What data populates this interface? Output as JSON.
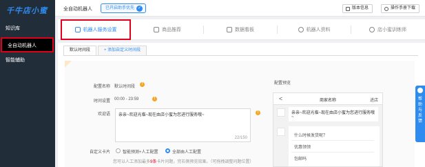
{
  "sidebar": {
    "logo": "千牛店小蜜",
    "items": [
      {
        "label": "知识库"
      },
      {
        "label": "全自动机器人"
      },
      {
        "label": "智能辅助"
      }
    ]
  },
  "topbar": {
    "title": "全自动机器人",
    "priority_badge": "已开启助手优先",
    "version_btn": "版本信息",
    "manual_btn": "操作手册下载"
  },
  "tabs": [
    {
      "label": "机器人服务设置",
      "icon": "robot-icon"
    },
    {
      "label": "商品推荐",
      "icon": "goods-icon"
    },
    {
      "label": "数据看板",
      "icon": "dashboard-icon"
    },
    {
      "label": "机器人资料",
      "icon": "robot-profile-icon"
    },
    {
      "label": "店小蜜训练师",
      "icon": "trainer-icon"
    }
  ],
  "subtabs": {
    "default": "默认时间段",
    "add_custom": "+ 添加自定义时间段"
  },
  "form": {
    "name_label": "配置名称",
    "name_value": "默认时间段",
    "time_label": "时间设置",
    "time_value": "00:00 - 23:59",
    "greeting_label": "欢迎语",
    "greeting_value": "亲亲~欢迎光临~现在由店小蜜为您进行服务哦~",
    "greeting_count": "22/150",
    "card_label": "自定义卡片",
    "option_smart": "智能预测+人工配置",
    "option_manual": "全部由人工配置",
    "hint_prefix": "您可以人工添加最多",
    "hint_count": "9条",
    "hint_suffix": "卡片问题，完右侧预览效果。（可拖拽调整问题位置）"
  },
  "preview": {
    "label": "配置预览",
    "header_back": "<",
    "header_title": "商家名称",
    "header_shop": "进店",
    "greeting": "亲亲~欢迎光临~现在由店小蜜为您进行服务哦~",
    "faq": [
      "什么时候发货呢？",
      "优惠领领",
      "包邮吗"
    ]
  },
  "help": {
    "label": "帮助与反馈"
  },
  "colors": {
    "accent": "#2e8cf0",
    "highlight_border": "#e0001b",
    "sidebar_bg": "#222d3a",
    "warning": "#f5a623"
  }
}
